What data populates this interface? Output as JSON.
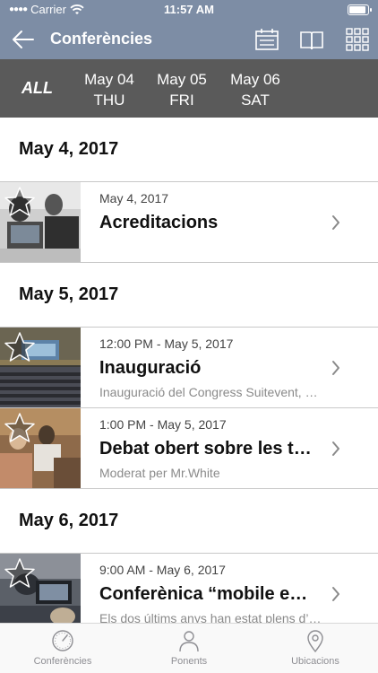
{
  "status": {
    "carrier": "Carrier",
    "time": "11:57 AM"
  },
  "nav": {
    "title": "Conferències",
    "icons": [
      "back-arrow-icon",
      "calendar-icon",
      "book-icon",
      "grid-icon"
    ]
  },
  "days": {
    "all": "ALL",
    "items": [
      {
        "date": "May 04",
        "weekday": "THU"
      },
      {
        "date": "May 05",
        "weekday": "FRI"
      },
      {
        "date": "May 06",
        "weekday": "SAT"
      }
    ]
  },
  "sections": [
    {
      "title": "May 4, 2017",
      "items": [
        {
          "meta": "May 4, 2017",
          "name": "Acreditacions",
          "desc": ""
        }
      ]
    },
    {
      "title": "May 5, 2017",
      "items": [
        {
          "meta": "12:00 PM - May 5, 2017",
          "name": "Inauguració",
          "desc": "Inauguració del Congress Suitevent, amb…"
        },
        {
          "meta": "1:00 PM - May 5, 2017",
          "name": "Debat obert sobre les tendències",
          "desc": "Moderat per Mr.White"
        }
      ]
    },
    {
      "title": "May 6, 2017",
      "items": [
        {
          "meta": "9:00 AM - May 6, 2017",
          "name": "Conferènica “mobile events”",
          "desc": "Els dos últims anys han estat plens d’esdeveniments"
        }
      ]
    }
  ],
  "tabs": [
    {
      "label": "Conferències",
      "icon": "clock-icon",
      "active": true
    },
    {
      "label": "Ponents",
      "icon": "person-icon",
      "active": false
    },
    {
      "label": "Ubicacions",
      "icon": "location-pin-icon",
      "active": false
    }
  ],
  "colors": {
    "navbar": "#7d8da5",
    "daybar": "#5a5a5a",
    "tabActive": "#8e8e93"
  }
}
